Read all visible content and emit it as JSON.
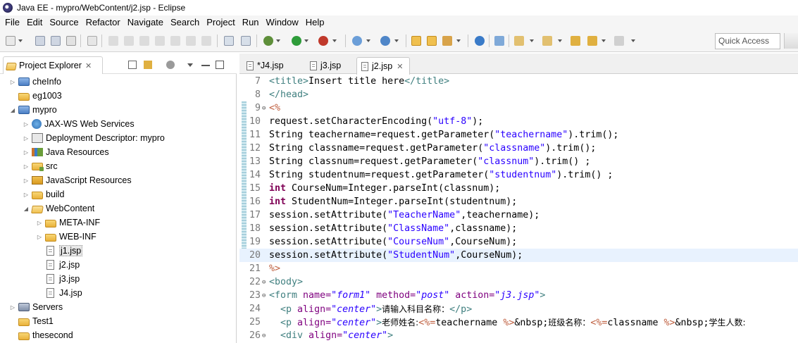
{
  "window": {
    "title": "Java EE - mypro/WebContent/j2.jsp - Eclipse"
  },
  "menu": [
    "File",
    "Edit",
    "Source",
    "Refactor",
    "Navigate",
    "Search",
    "Project",
    "Run",
    "Window",
    "Help"
  ],
  "toolbar": {
    "quick_access": "Quick Access"
  },
  "explorer": {
    "tab_label": "Project Explorer",
    "tab_close": "✕",
    "items": [
      {
        "label": "cheInfo",
        "level": 0,
        "expand": "closed",
        "icon": "project-icon"
      },
      {
        "label": "eg1003",
        "level": 0,
        "expand": "none",
        "icon": "folder-icon"
      },
      {
        "label": "mypro",
        "level": 0,
        "expand": "open",
        "icon": "project-icon"
      },
      {
        "label": "JAX-WS Web Services",
        "level": 1,
        "expand": "closed",
        "icon": "web-services-icon"
      },
      {
        "label": "Deployment Descriptor: mypro",
        "level": 1,
        "expand": "closed",
        "icon": "deployment-descriptor-icon"
      },
      {
        "label": "Java Resources",
        "level": 1,
        "expand": "closed",
        "icon": "java-resources-icon"
      },
      {
        "label": "src",
        "level": 1,
        "expand": "closed",
        "icon": "source-folder-icon"
      },
      {
        "label": "JavaScript Resources",
        "level": 1,
        "expand": "closed",
        "icon": "javascript-resources-icon"
      },
      {
        "label": "build",
        "level": 1,
        "expand": "closed",
        "icon": "folder-icon"
      },
      {
        "label": "WebContent",
        "level": 1,
        "expand": "open",
        "icon": "folder-open-icon"
      },
      {
        "label": "META-INF",
        "level": 2,
        "expand": "closed",
        "icon": "folder-icon"
      },
      {
        "label": "WEB-INF",
        "level": 2,
        "expand": "closed",
        "icon": "folder-icon"
      },
      {
        "label": "j1.jsp",
        "level": 2,
        "expand": "none",
        "icon": "jsp-file-icon",
        "selected": true
      },
      {
        "label": "j2.jsp",
        "level": 2,
        "expand": "none",
        "icon": "jsp-file-icon"
      },
      {
        "label": "j3.jsp",
        "level": 2,
        "expand": "none",
        "icon": "jsp-file-icon"
      },
      {
        "label": "J4.jsp",
        "level": 2,
        "expand": "none",
        "icon": "jsp-file-icon"
      },
      {
        "label": "Servers",
        "level": 0,
        "expand": "closed",
        "icon": "servers-icon"
      },
      {
        "label": "Test1",
        "level": 0,
        "expand": "none",
        "icon": "folder-icon"
      },
      {
        "label": "thesecond",
        "level": 0,
        "expand": "none",
        "icon": "folder-icon"
      }
    ]
  },
  "editor": {
    "tabs": [
      {
        "label": "*J4.jsp",
        "active": false
      },
      {
        "label": "j3.jsp",
        "active": false
      },
      {
        "label": "j2.jsp",
        "active": true,
        "close": "✕"
      }
    ],
    "lines": [
      {
        "n": "7",
        "fold": "",
        "tokens": [
          [
            "tag",
            "<title>"
          ],
          [
            "plain",
            "Insert title here"
          ],
          [
            "tag",
            "</title>"
          ]
        ]
      },
      {
        "n": "8",
        "fold": "",
        "tokens": [
          [
            "tag",
            "</head>"
          ]
        ]
      },
      {
        "n": "9",
        "fold": "⊖",
        "tokens": [
          [
            "jsp",
            "<%"
          ]
        ]
      },
      {
        "n": "10",
        "fold": "",
        "tokens": [
          [
            "plain",
            "request.setCharacterEncoding("
          ],
          [
            "str",
            "\"utf-8\""
          ],
          [
            "plain",
            ");"
          ]
        ]
      },
      {
        "n": "11",
        "fold": "",
        "tokens": [
          [
            "plain",
            "String teachername=request.getParameter("
          ],
          [
            "str",
            "\"teachername\""
          ],
          [
            "plain",
            ").trim();"
          ]
        ]
      },
      {
        "n": "12",
        "fold": "",
        "tokens": [
          [
            "plain",
            "String classname=request.getParameter("
          ],
          [
            "str",
            "\"classname\""
          ],
          [
            "plain",
            ").trim();"
          ]
        ]
      },
      {
        "n": "13",
        "fold": "",
        "tokens": [
          [
            "plain",
            "String classnum=request.getParameter("
          ],
          [
            "str",
            "\"classnum\""
          ],
          [
            "plain",
            ").trim() ;"
          ]
        ]
      },
      {
        "n": "14",
        "fold": "",
        "tokens": [
          [
            "plain",
            "String studentnum=request.getParameter("
          ],
          [
            "str",
            "\"studentnum\""
          ],
          [
            "plain",
            ").trim() ;"
          ]
        ]
      },
      {
        "n": "15",
        "fold": "",
        "tokens": [
          [
            "kw",
            "int"
          ],
          [
            "plain",
            " CourseNum=Integer.parseInt(classnum);"
          ]
        ]
      },
      {
        "n": "16",
        "fold": "",
        "tokens": [
          [
            "kw",
            "int"
          ],
          [
            "plain",
            " StudentNum=Integer.parseInt(studentnum);"
          ]
        ]
      },
      {
        "n": "17",
        "fold": "",
        "tokens": [
          [
            "plain",
            "session.setAttribute("
          ],
          [
            "str",
            "\"TeacherName\""
          ],
          [
            "plain",
            ",teachername);"
          ]
        ]
      },
      {
        "n": "18",
        "fold": "",
        "tokens": [
          [
            "plain",
            "session.setAttribute("
          ],
          [
            "str",
            "\"ClassName\""
          ],
          [
            "plain",
            ",classname);"
          ]
        ]
      },
      {
        "n": "19",
        "fold": "",
        "tokens": [
          [
            "plain",
            "session.setAttribute("
          ],
          [
            "str",
            "\"CourseNum\""
          ],
          [
            "plain",
            ",CourseNum);"
          ]
        ]
      },
      {
        "n": "20",
        "fold": "",
        "current": true,
        "tokens": [
          [
            "plain",
            "session.setAttribute("
          ],
          [
            "str",
            "\"StudentNum\""
          ],
          [
            "plain",
            ",CourseNum);"
          ]
        ]
      },
      {
        "n": "21",
        "fold": "",
        "tokens": [
          [
            "jsp",
            "%>"
          ]
        ]
      },
      {
        "n": "22",
        "fold": "⊖",
        "tokens": [
          [
            "tag",
            "<body>"
          ]
        ]
      },
      {
        "n": "23",
        "fold": "⊖",
        "tokens": [
          [
            "tag",
            "<form "
          ],
          [
            "attr",
            "name="
          ],
          [
            "val",
            "\"form1\""
          ],
          [
            "plain",
            " "
          ],
          [
            "attr",
            "method="
          ],
          [
            "val",
            "\"post\""
          ],
          [
            "plain",
            " "
          ],
          [
            "attr",
            "action="
          ],
          [
            "val",
            "\"j3.jsp\""
          ],
          [
            "tag",
            ">"
          ]
        ]
      },
      {
        "n": "24",
        "fold": "",
        "tokens": [
          [
            "plain",
            "  "
          ],
          [
            "tag",
            "<p "
          ],
          [
            "attr",
            "align="
          ],
          [
            "val",
            "\"center\""
          ],
          [
            "tag",
            ">"
          ],
          [
            "cjk",
            "请输入科目名称："
          ],
          [
            "tag",
            "</p>"
          ]
        ]
      },
      {
        "n": "25",
        "fold": "",
        "tokens": [
          [
            "plain",
            "  "
          ],
          [
            "tag",
            "<p "
          ],
          [
            "attr",
            "align="
          ],
          [
            "val",
            "\"center\""
          ],
          [
            "tag",
            ">"
          ],
          [
            "cjk",
            "老师姓名:"
          ],
          [
            "jsp",
            "<%="
          ],
          [
            "plain",
            "teachername "
          ],
          [
            "jsp",
            "%>"
          ],
          [
            "plain",
            "&nbsp;"
          ],
          [
            "cjk",
            "班级名称："
          ],
          [
            "jsp",
            "<%="
          ],
          [
            "plain",
            "classname "
          ],
          [
            "jsp",
            "%>"
          ],
          [
            "plain",
            "&nbsp;"
          ],
          [
            "cjk",
            "学生人数:"
          ]
        ]
      },
      {
        "n": "26",
        "fold": "⊖",
        "tokens": [
          [
            "plain",
            "  "
          ],
          [
            "tag",
            "<div "
          ],
          [
            "attr",
            "align="
          ],
          [
            "val",
            "\"center\""
          ],
          [
            "tag",
            ">"
          ]
        ]
      }
    ]
  }
}
